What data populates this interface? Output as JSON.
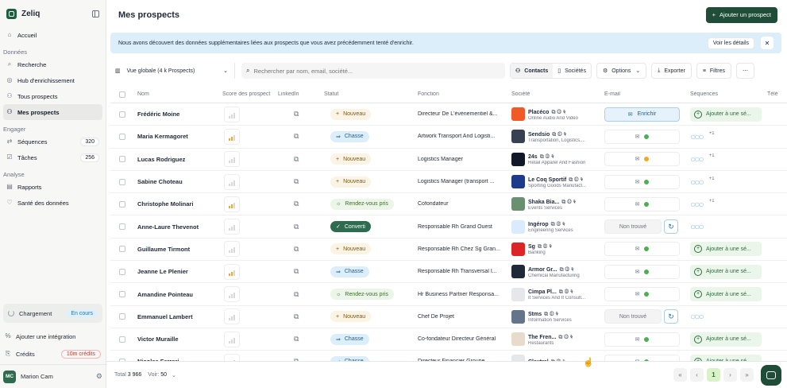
{
  "app": {
    "name": "Zeliq"
  },
  "sidebar": {
    "items": [
      {
        "label": "Accueil",
        "icon": "home-icon"
      }
    ],
    "sections": [
      {
        "title": "Données",
        "items": [
          {
            "label": "Recherche",
            "icon": "search-icon"
          },
          {
            "label": "Hub d'enrichissement",
            "icon": "hub-icon"
          },
          {
            "label": "Tous prospects",
            "icon": "users-icon"
          },
          {
            "label": "Mes prospects",
            "icon": "user-group-icon",
            "active": true
          }
        ]
      },
      {
        "title": "Engager",
        "items": [
          {
            "label": "Séquences",
            "icon": "sequence-icon",
            "count": "320"
          },
          {
            "label": "Tâches",
            "icon": "task-icon",
            "count": "256"
          }
        ]
      },
      {
        "title": "Analyse",
        "items": [
          {
            "label": "Rapports",
            "icon": "chart-icon"
          },
          {
            "label": "Santé des données",
            "icon": "heart-icon"
          }
        ]
      }
    ],
    "loading": {
      "label": "Chargement",
      "status": "En cours"
    },
    "integration": "Ajouter une intégration",
    "credits": {
      "label": "Crédits",
      "value": "10m crédits"
    },
    "user": {
      "initials": "MC",
      "name": "Marion Cam"
    }
  },
  "header": {
    "title": "Mes prospects",
    "add_button": "Ajouter un prospect"
  },
  "banner": {
    "text": "Nous avons découvert des données supplémentaires liées aux prospects que vous avez précédemment tenté d'enrichir.",
    "details_button": "Voir les détails"
  },
  "toolbar": {
    "view": "Vue globale (4 k Prospects)",
    "search_placeholder": "Rechercher par nom, email, société...",
    "contacts": "Contacts",
    "societes": "Sociétés",
    "options": "Options",
    "exporter": "Exporter",
    "filtres": "Filtres"
  },
  "table": {
    "columns": [
      "Nom",
      "Score des prospect",
      "LinkedIn",
      "Statut",
      "Fonction",
      "Société",
      "E-mail",
      "Séquences",
      "Télé"
    ],
    "rows": [
      {
        "name": "Frédéric Moine",
        "score": 1,
        "status": "Nouveau",
        "function": "Directeur De L'évènementiel &...",
        "company": "Placéco",
        "company_desc": "Online Audio And Video",
        "logo_color": "#f05a28",
        "email": "Enrichir",
        "email_state": "enrich",
        "seq": "Ajouter à une sé...",
        "seq_state": "add"
      },
      {
        "name": "Maria Kermagoret",
        "score": 2,
        "status": "Chasse",
        "function": "Artwork Transport And Logisti...",
        "company": "Sendsio",
        "company_desc": "Transportation, Logistics,...",
        "logo_color": "#374151",
        "email_state": "ok",
        "seq_state": "circles",
        "seq_plus": "+1"
      },
      {
        "name": "Lucas Rodriguez",
        "score": 1,
        "status": "Nouveau",
        "function": "Logistics Manager",
        "company": "24s",
        "company_desc": "Retail Apparel And Fashion",
        "logo_color": "#111827",
        "email_state": "warn",
        "seq_state": "circles",
        "seq_plus": "+1"
      },
      {
        "name": "Sabine Choteau",
        "score": 1,
        "status": "Nouveau",
        "function": "Logistics Manager (transport ...",
        "company": "Le Coq Sportif",
        "company_desc": "Sporting Goods Manufact...",
        "logo_color": "#1e3a8a",
        "email_state": "ok",
        "seq_state": "circles",
        "seq_plus": "+1"
      },
      {
        "name": "Christophe Molinari",
        "score": 2,
        "status": "Rendez-vous pris",
        "function": "Cofondateur",
        "company": "Shaka Bia...",
        "company_desc": "Events Services",
        "logo_color": "#6b8f71",
        "email_state": "ok",
        "seq_state": "circles",
        "seq_plus": "+1"
      },
      {
        "name": "Anne-Laure Thevenot",
        "score": 1,
        "status": "Converti",
        "function": "Responsable Rh Grand Ouest",
        "company": "Ingérop",
        "company_desc": "Engineering Services",
        "logo_color": "#dbeafe",
        "email": "Non trouvé",
        "email_state": "notfound",
        "seq_state": "circles"
      },
      {
        "name": "Guillaume Tirmont",
        "score": 1,
        "status": "Nouveau",
        "function": "Responsable Rh Chez Sg Gran...",
        "company": "Sg",
        "company_desc": "Banking",
        "logo_color": "#dc2626",
        "email_state": "ok",
        "seq": "Ajouter à une sé...",
        "seq_state": "add"
      },
      {
        "name": "Jeanne Le Plenier",
        "score": 2,
        "status": "Chasse",
        "function": "Responsable Rh Transversal I...",
        "company": "Armor Gr...",
        "company_desc": "Chemical Manufacturing",
        "logo_color": "#1f2937",
        "email_state": "ok",
        "seq": "Ajouter à une sé...",
        "seq_state": "add"
      },
      {
        "name": "Amandine Pointeau",
        "score": 1,
        "status": "Rendez-vous pris",
        "function": "Hr Business Partner Responsa...",
        "company": "Cimpa Pl...",
        "company_desc": "It Services And It Consult...",
        "logo_color": "#e5e7eb",
        "email_state": "ok",
        "seq": "Ajouter à une sé...",
        "seq_state": "add"
      },
      {
        "name": "Emmanuel Lambert",
        "score": 1,
        "status": "Nouveau",
        "function": "Chef De Projet",
        "company": "Stms",
        "company_desc": "Information Services",
        "logo_color": "#64748b",
        "email": "Non trouvé",
        "email_state": "notfound",
        "seq_state": "circles"
      },
      {
        "name": "Victor Muraille",
        "score": 1,
        "status": "Chasse",
        "function": "Co-fondateur Directeur Général",
        "company": "The Fren...",
        "company_desc": "Restaurants",
        "logo_color": "#e7dccb",
        "email_state": "ok",
        "seq": "Ajouter à une sé...",
        "seq_state": "add"
      },
      {
        "name": "Nicolas Ferrari",
        "score": 1,
        "status": "Chasse",
        "function": "Directeur Financier Groupe",
        "company": "Clextral",
        "company_desc": "",
        "logo_color": "#e5e7eb",
        "email_state": "ok",
        "seq": "Ajouter à une sé...",
        "seq_state": "add"
      }
    ]
  },
  "footer": {
    "total_label": "Total",
    "total": "3 966",
    "per_page_label": "Voir:",
    "per_page": "50",
    "page": "1"
  }
}
